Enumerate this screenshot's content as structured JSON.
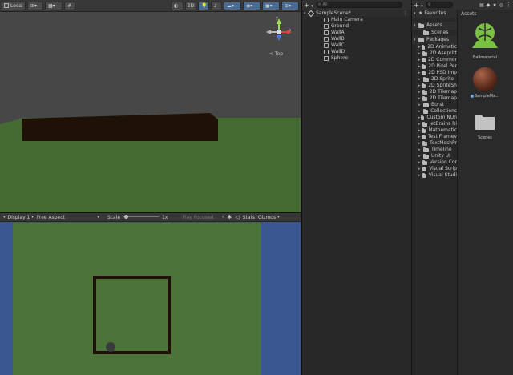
{
  "scene_toolbar": {
    "pivot_label": "Local",
    "mode_2d": "2D",
    "gizmo_label": "< Top",
    "gizmo_axes": {
      "x": "x",
      "y": "y",
      "z": "z"
    }
  },
  "game_toolbar": {
    "display": "Display 1",
    "aspect": "Free Aspect",
    "scale_label": "Scale",
    "scale_value": "1x",
    "play_focused": "Play Focused",
    "stats": "Stats",
    "gizmos": "Gizmos"
  },
  "hierarchy": {
    "search_placeholder": "All",
    "scene_name": "SampleScene*",
    "items": [
      "Main Camera",
      "Ground",
      "WallA",
      "WallB",
      "WallC",
      "WallD",
      "Sphere"
    ]
  },
  "project": {
    "favorites_label": "Favorites",
    "assets_label": "Assets",
    "assets_children": [
      "Scenes"
    ],
    "packages_label": "Packages",
    "packages": [
      "2D Animatic",
      "2D Asepritt",
      "2D Commor",
      "2D Pixel Per",
      "2D PSD Imp",
      "2D Sprite",
      "2D SpriteSh",
      "2D Tilemap",
      "2D Tilemap",
      "Burst",
      "Collections",
      "Custom NUn",
      "JetBrains Ri",
      "Mathematic",
      "Test Framev",
      "TextMeshPr",
      "Timeline",
      "Unity UI",
      "Version Cor",
      "Visual Scrip",
      "Visual Studi"
    ],
    "breadcrumb": "Assets",
    "grid_items": [
      "Ballmaterial",
      "SampleMa...",
      "Scenes"
    ]
  },
  "colors": {
    "scene_sky": "#474747",
    "ground_green": "#456a32",
    "wall_dark": "#1e1208",
    "game_bg": "#3b5791",
    "game_ground": "#4d7438",
    "sphere": "#3a3a3a"
  }
}
